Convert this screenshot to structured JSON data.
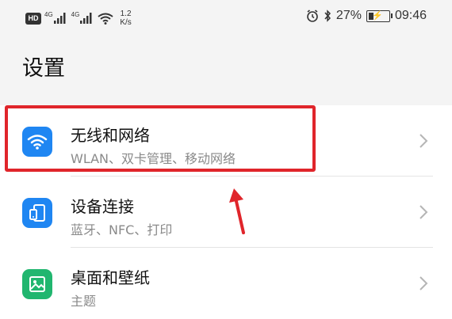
{
  "status_bar": {
    "hd_label": "HD",
    "network_1": "4G",
    "network_2": "4G",
    "speed_value": "1.2",
    "speed_unit": "K/s",
    "battery_percent": "27%",
    "time": "09:46",
    "battery_level": 0.27
  },
  "page_title": "设置",
  "settings_items": [
    {
      "title": "无线和网络",
      "subtitle": "WLAN、双卡管理、移动网络",
      "icon": "wifi-icon",
      "color": "#1f86f2"
    },
    {
      "title": "设备连接",
      "subtitle": "蓝牙、NFC、打印",
      "icon": "device-connect-icon",
      "color": "#1f86f2"
    },
    {
      "title": "桌面和壁纸",
      "subtitle": "主题",
      "icon": "wallpaper-icon",
      "color": "#21b66f"
    }
  ],
  "annotation": {
    "highlight_color": "#e0252b"
  }
}
